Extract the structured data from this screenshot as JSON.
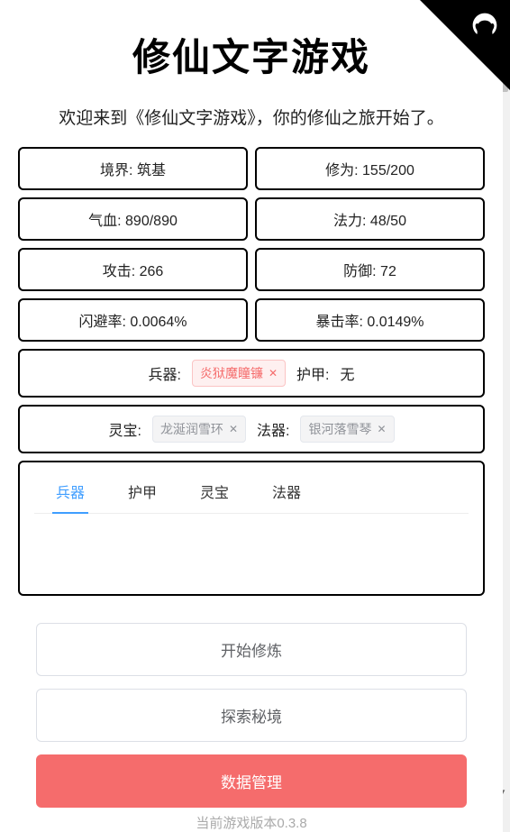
{
  "title": "修仙文字游戏",
  "welcome": "欢迎来到《修仙文字游戏》，你的修仙之旅开始了。",
  "stats": {
    "realm_label": "境界:",
    "realm_value": "筑基",
    "cultivation_label": "修为:",
    "cultivation_value": "155/200",
    "hp_label": "气血:",
    "hp_value": "890/890",
    "mp_label": "法力:",
    "mp_value": "48/50",
    "atk_label": "攻击:",
    "atk_value": "266",
    "def_label": "防御:",
    "def_value": "72",
    "dodge_label": "闪避率:",
    "dodge_value": "0.0064%",
    "crit_label": "暴击率:",
    "crit_value": "0.0149%"
  },
  "equipment": {
    "weapon_label": "兵器:",
    "weapon_name": "炎狱魔瞳镰",
    "armor_label": "护甲:",
    "armor_value": "无",
    "treasure_label": "灵宝:",
    "treasure_name": "龙涎润雪环",
    "artifact_label": "法器:",
    "artifact_name": "银河落雪琴"
  },
  "tabs": {
    "weapon": "兵器",
    "armor": "护甲",
    "treasure": "灵宝",
    "artifact": "法器"
  },
  "actions": {
    "cultivate": "开始修炼",
    "explore": "探索秘境",
    "data": "数据管理"
  },
  "version": "当前游戏版本0.3.8"
}
